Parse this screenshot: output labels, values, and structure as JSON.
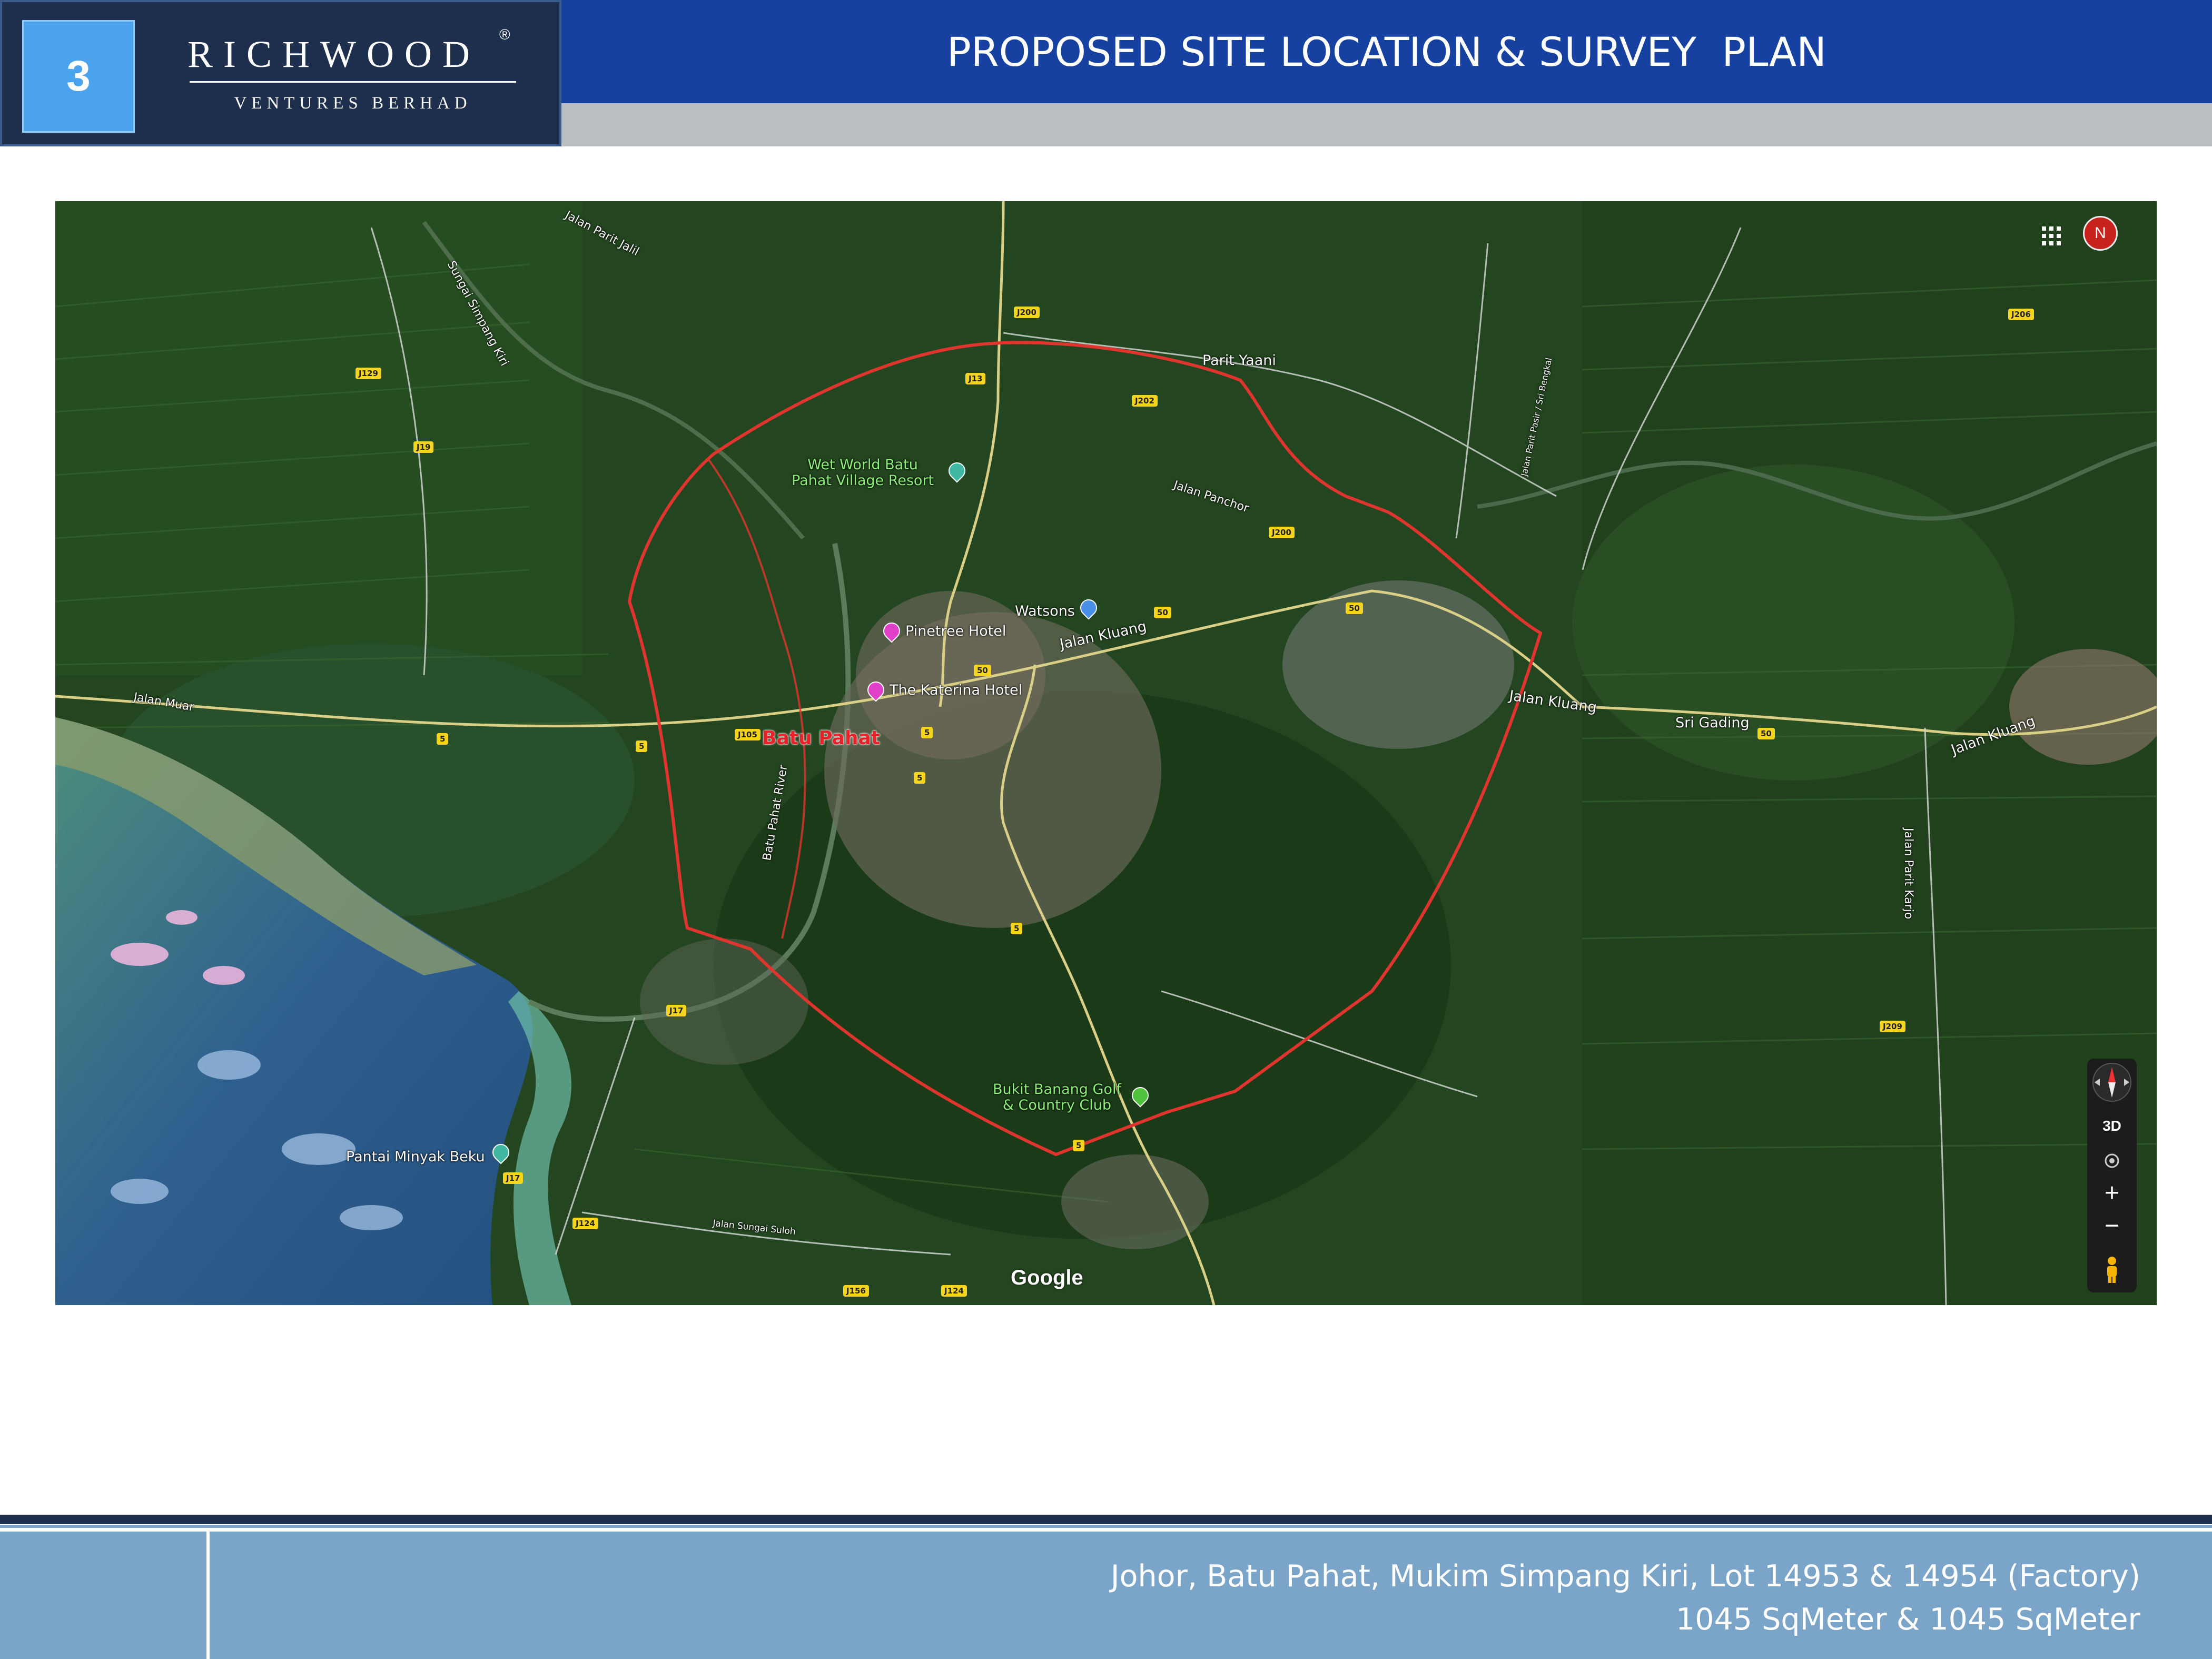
{
  "header": {
    "page_number": "3",
    "brand_name": "RICHWOOD",
    "brand_registered": "®",
    "brand_subtitle": "VENTURES BERHAD",
    "title": "PROPOSED SITE LOCATION & SURVEY  PLAN"
  },
  "map": {
    "labels": {
      "sungai_simpang_kiri": "Sungai Simpang Kiri",
      "jalan_parit_jalil": "Jalan Parit Jalil",
      "parit_yaani": "Parit Yaani",
      "wet_world": "Wet World Batu\nPahat Village Resort",
      "jalan_panchor": "Jalan Panchor",
      "watsons": "Watsons",
      "jalan_kluang_1": "Jalan Kluang",
      "pinetree": "Pinetree Hotel",
      "katerina": "The Katerina Hotel",
      "batu_pahat": "Batu Pahat",
      "jalan_muar": "Jalan Muar",
      "batu_pahat_river": "Batu Pahat River",
      "jalan_kluang_2": "Jalan Kluang",
      "sri_gading": "Sri Gading",
      "jalan_kluang_3": "Jalan Kluang",
      "jalan_parit_karjo": "Jalan Parit Karjo",
      "jalan_parit_pasir": "Jalan Parit Pasir / Sri Bengkal",
      "bukit_banang": "Bukit Banang Golf\n& Country Club",
      "pantai_minyak_beku": "Pantai Minyak Beku",
      "jalan_sungai_suloh": "Jalan Sungai Suloh"
    },
    "road_signs": {
      "j200_top": "J200",
      "j13": "J13",
      "j202": "J202",
      "j200_mid": "J200",
      "j129": "J129",
      "j19": "J19",
      "r50_a": "50",
      "r50_b": "50",
      "r50_c": "50",
      "r50_d": "50",
      "r5_a": "5",
      "r5_b": "5",
      "r5_c": "5",
      "r5_d": "5",
      "r5_e": "5",
      "r5_f": "5",
      "j105": "J105",
      "j17_a": "J17",
      "j17_b": "J17",
      "j124": "J124",
      "j206": "J206",
      "j209": "J209",
      "j124_b": "J124",
      "j156": "J156"
    },
    "google_watermark": "Google",
    "avatar_initial": "N",
    "controls": {
      "three_d": "3D",
      "zoom_in": "+",
      "zoom_out": "−"
    }
  },
  "footer": {
    "location": "Johor, Batu Pahat, Mukim Simpang Kiri, Lot 14953 & 14954 (Factory)",
    "area": "1045 SqMeter & 1045 SqMeter"
  }
}
